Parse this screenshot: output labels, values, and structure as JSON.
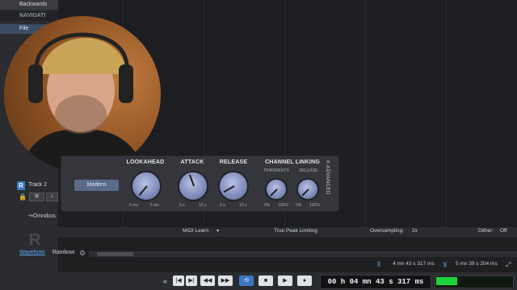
{
  "left_panel": {
    "backwards": "Backwards",
    "navigator": "NAVIGATI",
    "file": "File",
    "track_r": "R",
    "track_name": "Track 2",
    "omnibus": "↪Omnibus",
    "big_r": "R",
    "tab_waveform": "Waveform",
    "tab_rainbow": "Rainbow"
  },
  "plugin": {
    "mode": "Modern",
    "lookahead": {
      "label": "LOOKAHEAD",
      "min": "0 ms",
      "max": "5 ms"
    },
    "attack": {
      "label": "ATTACK",
      "min": "0 s",
      "max": "10 s"
    },
    "release": {
      "label": "RELEASE",
      "min": "0 s",
      "max": "10 s"
    },
    "channel_linking": {
      "label": "CHANNEL LINKING",
      "transients": {
        "label": "TRANSIENTS",
        "min": "0%",
        "max": "100%"
      },
      "release": {
        "label": "RELEASE",
        "min": "0%",
        "max": "100%"
      }
    },
    "advanced": "ADVANCED",
    "chevron": "»"
  },
  "plugin_bar": {
    "midi_learn": "MIDI Learn",
    "true_peak": "True Peak Limiting",
    "oversampling_label": "Oversampling:",
    "oversampling_value": "2x",
    "dither_label": "Dither:",
    "dither_value": "Off"
  },
  "timeline": {
    "time1": "4 mn 43 s 317 ms",
    "time2": "5 mn 39 s 204 ms"
  },
  "transport": {
    "timecode": "00 h 04 mn 43 s 317 ms",
    "buttons": [
      "«",
      "|◀",
      "▶|",
      "◀◀",
      "▶▶",
      "⟲",
      "■",
      "▶",
      "●"
    ],
    "level_fraction": 0.28
  },
  "colors": {
    "accent_blue": "#3a78c2",
    "level_green": "#1fd33b",
    "knob_blue": "#8e9ac6"
  }
}
